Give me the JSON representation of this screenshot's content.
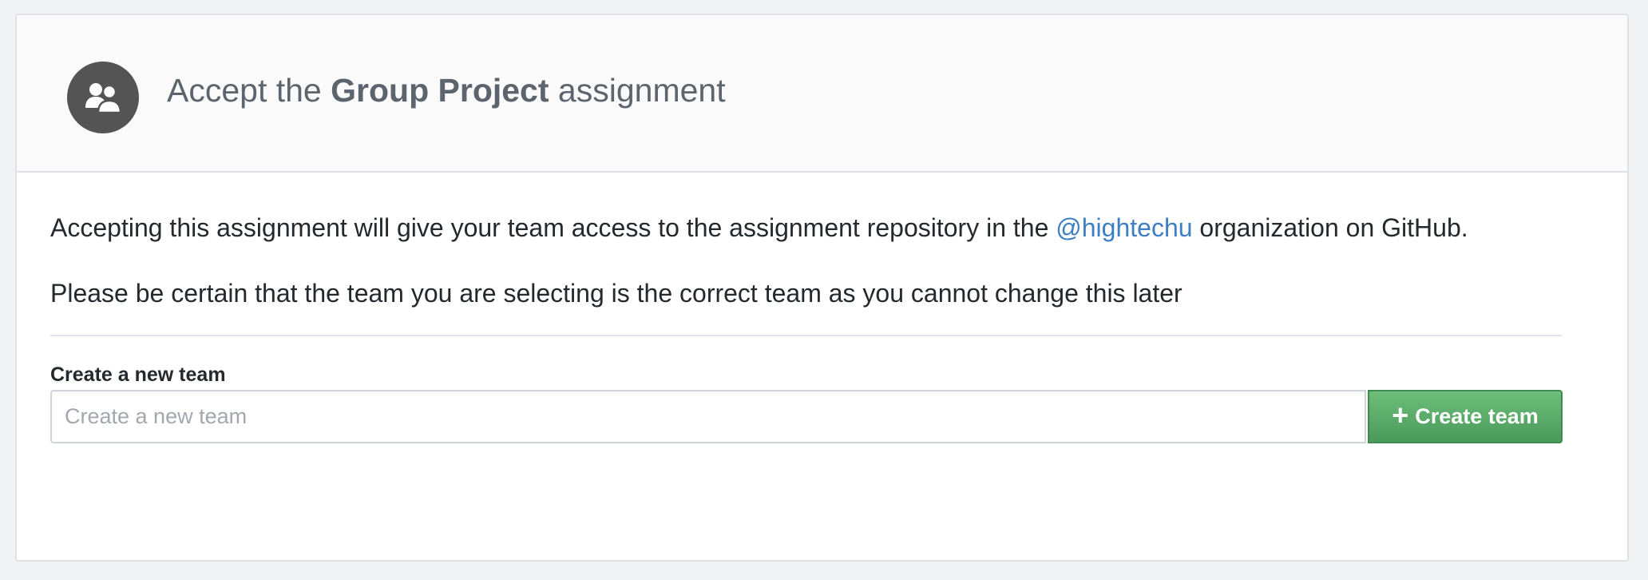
{
  "header": {
    "title_prefix": "Accept the",
    "assignment_name": "Group Project",
    "title_suffix": "assignment",
    "avatar_icon": "team-icon"
  },
  "body": {
    "access_text_before": "Accepting this assignment will give your team access to the assignment repository in the",
    "org_link": "@hightechu",
    "access_text_after": "organization on GitHub.",
    "warning_text": "Please be certain that the team you are selecting is the correct team as you cannot change this later"
  },
  "form": {
    "label": "Create a new team",
    "placeholder": "Create a new team",
    "value": "",
    "button_icon": "plus-icon",
    "button_label": "Create team"
  },
  "colors": {
    "link": "#3e7ec2",
    "button": "#54a364",
    "avatar": "#545454"
  }
}
